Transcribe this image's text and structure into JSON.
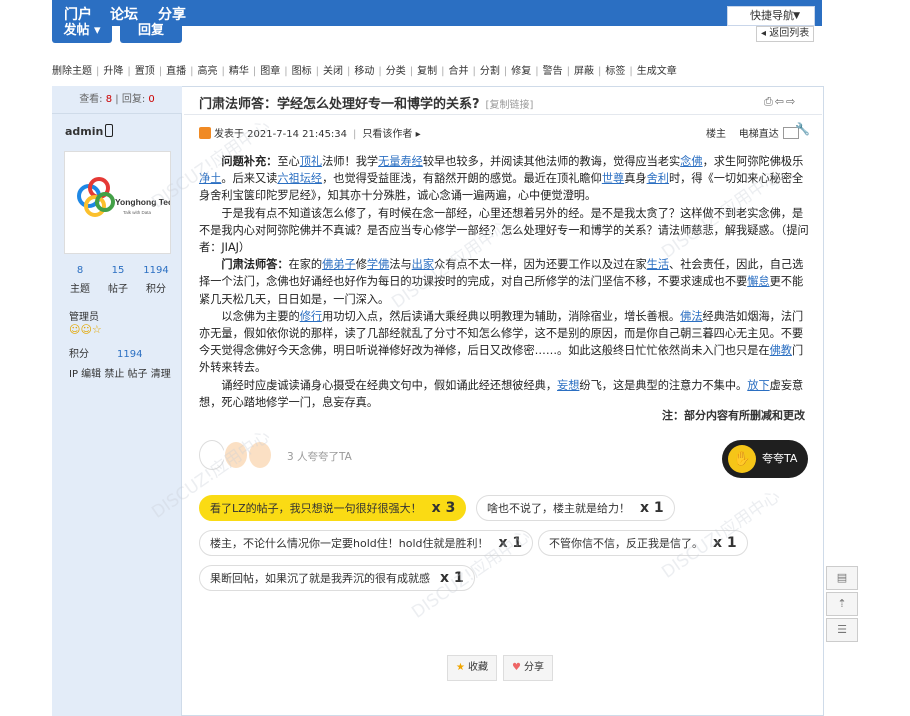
{
  "topnav": {
    "items": [
      "门户",
      "论坛",
      "分享"
    ],
    "quicknav": "快捷导航"
  },
  "actions": {
    "post": "发帖",
    "reply": "回复",
    "back": "返回列表"
  },
  "admin_tools": [
    "删除主题",
    "升降",
    "置顶",
    "直播",
    "高亮",
    "精华",
    "图章",
    "图标",
    "关闭",
    "移动",
    "分类",
    "复制",
    "合并",
    "分割",
    "修复",
    "警告",
    "屏蔽",
    "标签",
    "生成文章"
  ],
  "side": {
    "views_label": "查看:",
    "views": "8",
    "replies_label": "回复:",
    "replies": "0",
    "author": "admin",
    "avatar_brand": "Yonghong Tech",
    "avatar_slogan": "Talk with Data",
    "stats": [
      {
        "value": "8",
        "label": "主题"
      },
      {
        "value": "15",
        "label": "帖子"
      },
      {
        "value": "1194",
        "label": "积分"
      }
    ],
    "group": "管理员",
    "credit_label": "积分",
    "credit_value": "1194",
    "tools": "IP 编辑 禁止 帖子 清理"
  },
  "thread": {
    "title": "门肃法师答：学经怎么处理好专一和博学的关系?",
    "copy_link": "[复制链接]",
    "posted": "发表于 2021-7-14 21:45:34",
    "only_author": "只看该作者",
    "floor": "楼主",
    "elevator": "电梯直达",
    "note": "注：部分内容有所删减和更改"
  },
  "praise": {
    "text": "3 人夸夸了TA",
    "button": "夸夸TA"
  },
  "tags": [
    {
      "text": "看了LZ的帖子，我只想说一句很好很强大！",
      "count": "x 3",
      "hot": true
    },
    {
      "text": "啥也不说了，楼主就是给力！",
      "count": "x 1",
      "hot": false
    },
    {
      "text": "楼主，不论什么情况你一定要hold住！hold住就是胜利！",
      "count": "x 1",
      "hot": false
    },
    {
      "text": "不管你信不信，反正我是信了。",
      "count": "x 1",
      "hot": false
    },
    {
      "text": "果断回帖，如果沉了就是我弄沉的很有成就感",
      "count": "x 1",
      "hot": false
    }
  ],
  "bottom": {
    "favorite": "收藏",
    "share": "分享"
  },
  "colors": {
    "brand": "#2b6fc2",
    "sidebar": "#e3ecf8",
    "hot_tag": "#fadb14",
    "praise_btn": "#1f1f1f"
  }
}
